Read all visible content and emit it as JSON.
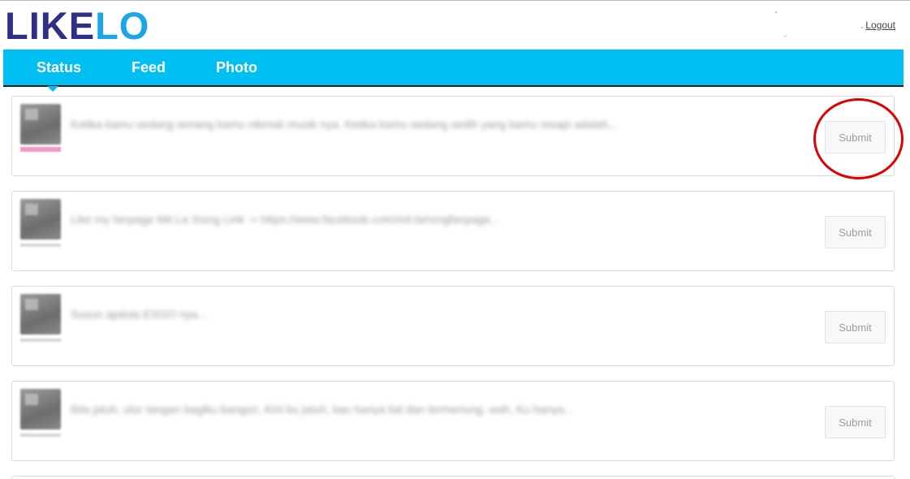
{
  "app": {
    "logo_part1": "LIKE",
    "logo_part2": "LO",
    "logout_label": "Logout"
  },
  "nav": {
    "tabs": [
      {
        "label": "Status",
        "active": true
      },
      {
        "label": "Feed",
        "active": false
      },
      {
        "label": "Photo",
        "active": false
      }
    ]
  },
  "posts": [
    {
      "text": "Ketika kamu sedang senang kamu nikmati musik nya. Ketika kamu sedang sedih yang kamu resapi adalah...",
      "submit_label": "Submit"
    },
    {
      "text": "Like my fanpage Mit La Xiong Link -> https://www.facebook.com/mit.la/rongfanpage...",
      "submit_label": "Submit"
    },
    {
      "text": "Susun apdola ESGO nya...",
      "submit_label": "Submit"
    },
    {
      "text": "Bila jatuh, ulur tangan bagiku bangun, Kini ku jatuh, kau hanya liat dan termenung, wah, Ku hanya...",
      "submit_label": "Submit"
    }
  ],
  "colors": {
    "navbar": "#00bff3",
    "logo_dark": "#2e2f86",
    "logo_light": "#1aa7e8",
    "highlight": "#e00000"
  }
}
